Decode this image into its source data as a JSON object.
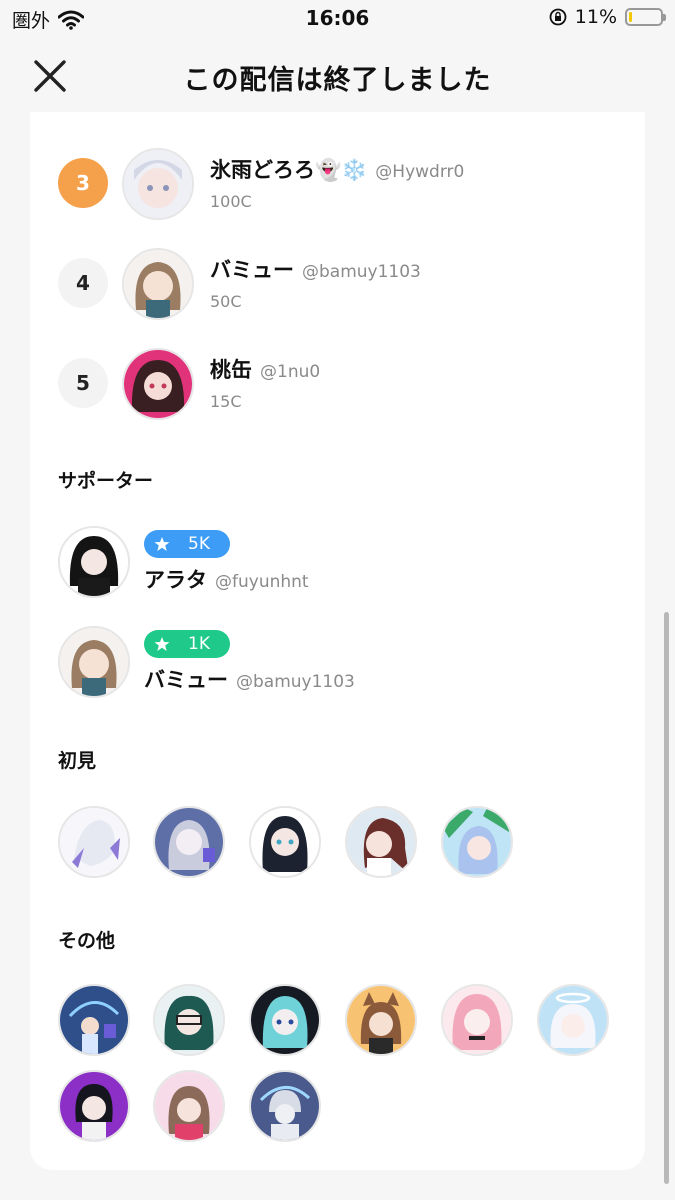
{
  "status_bar": {
    "carrier": "圏外",
    "time": "16:06",
    "battery": "11%",
    "battery_level": 0.11
  },
  "header": {
    "title": "この配信は終了しました"
  },
  "ranking": [
    {
      "rank": "3",
      "name": "氷雨どろろ",
      "emoji": "👻❄️",
      "handle": "@Hywdrr0",
      "coins": "100C"
    },
    {
      "rank": "4",
      "name": "バミュー",
      "emoji": "",
      "handle": "@bamuy1103",
      "coins": "50C"
    },
    {
      "rank": "5",
      "name": "桃缶",
      "emoji": "",
      "handle": "@1nu0",
      "coins": "15C"
    }
  ],
  "supporters": {
    "title": "サポーター",
    "items": [
      {
        "badge": "5K",
        "badge_color": "#3d9cf5",
        "name": "アラタ",
        "handle": "@fuyunhnt"
      },
      {
        "badge": "1K",
        "badge_color": "#1ec98a",
        "name": "バミュー",
        "handle": "@bamuy1103"
      }
    ]
  },
  "first_timers": {
    "title": "初見",
    "count": 5
  },
  "others": {
    "title": "その他",
    "count": 9
  },
  "colors": {
    "top_rank": "#f5a04a",
    "accent_blue": "#3d9cf5",
    "accent_green": "#1ec98a"
  }
}
